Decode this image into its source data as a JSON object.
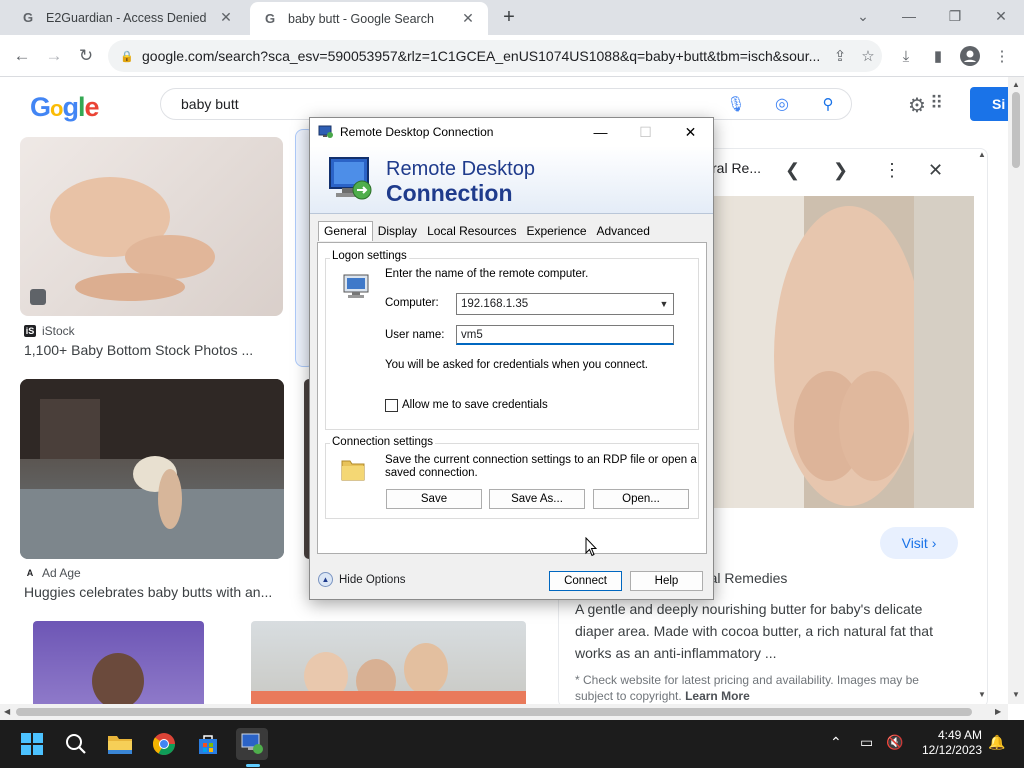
{
  "tabs": [
    {
      "title": "E2Guardian - Access Denied",
      "close": "✕"
    },
    {
      "title": "baby butt - Google Search",
      "close": "✕"
    }
  ],
  "new_tab": "+",
  "address_bar": {
    "url": "google.com/search?sca_esv=590053957&rlz=1C1GCEA_enUS1074US1088&q=baby+butt&tbm=isch&sour..."
  },
  "google": {
    "logo": [
      "G",
      "o",
      "g",
      "l",
      "e"
    ],
    "query": "baby butt",
    "signin": "Si"
  },
  "results": [
    {
      "source": "iStock",
      "caption": "1,100+ Baby Bottom Stock Photos ..."
    },
    {
      "source": "Ad Age",
      "caption": "Huggies celebrates baby butts with an..."
    }
  ],
  "preview": {
    "title_fragment": "ral Re...",
    "visit_label": "Visit",
    "brand": "rand: Ivy Nicole Natural Remedies",
    "description": "A gentle and deeply nourishing butter for baby's delicate diaper area. Made with cocoa butter, a rich natural fat that works as an anti-inflammatory ...",
    "note_prefix": "* Check website for latest pricing and availability. Images may be subject to copyright.",
    "learn_more": "Learn More"
  },
  "rdp": {
    "window_title": "Remote Desktop Connection",
    "banner_line1": "Remote Desktop",
    "banner_line2": "Connection",
    "tabs": [
      "General",
      "Display",
      "Local Resources",
      "Experience",
      "Advanced"
    ],
    "logon_group": "Logon settings",
    "logon_intro": "Enter the name of the remote computer.",
    "computer_label": "Computer:",
    "computer_value": "192.168.1.35",
    "user_label": "User name:",
    "user_value": "vm5",
    "credentials_note": "You will be asked for credentials when you connect.",
    "save_creds_label": "Allow me to save credentials",
    "conn_group": "Connection settings",
    "conn_desc_1": "Save the current connection settings to an RDP file or open a",
    "conn_desc_2": "saved connection.",
    "save_btn": "Save",
    "save_as_btn": "Save As...",
    "open_btn": "Open...",
    "hide_options": "Hide Options",
    "connect_btn": "Connect",
    "help_btn": "Help"
  },
  "clock": {
    "time": "4:49 AM",
    "date": "12/12/2023"
  },
  "colors": {
    "accent": "#1a73e8",
    "rdp_blue": "#1f3b8c",
    "taskbar": "#1c1c1c"
  }
}
